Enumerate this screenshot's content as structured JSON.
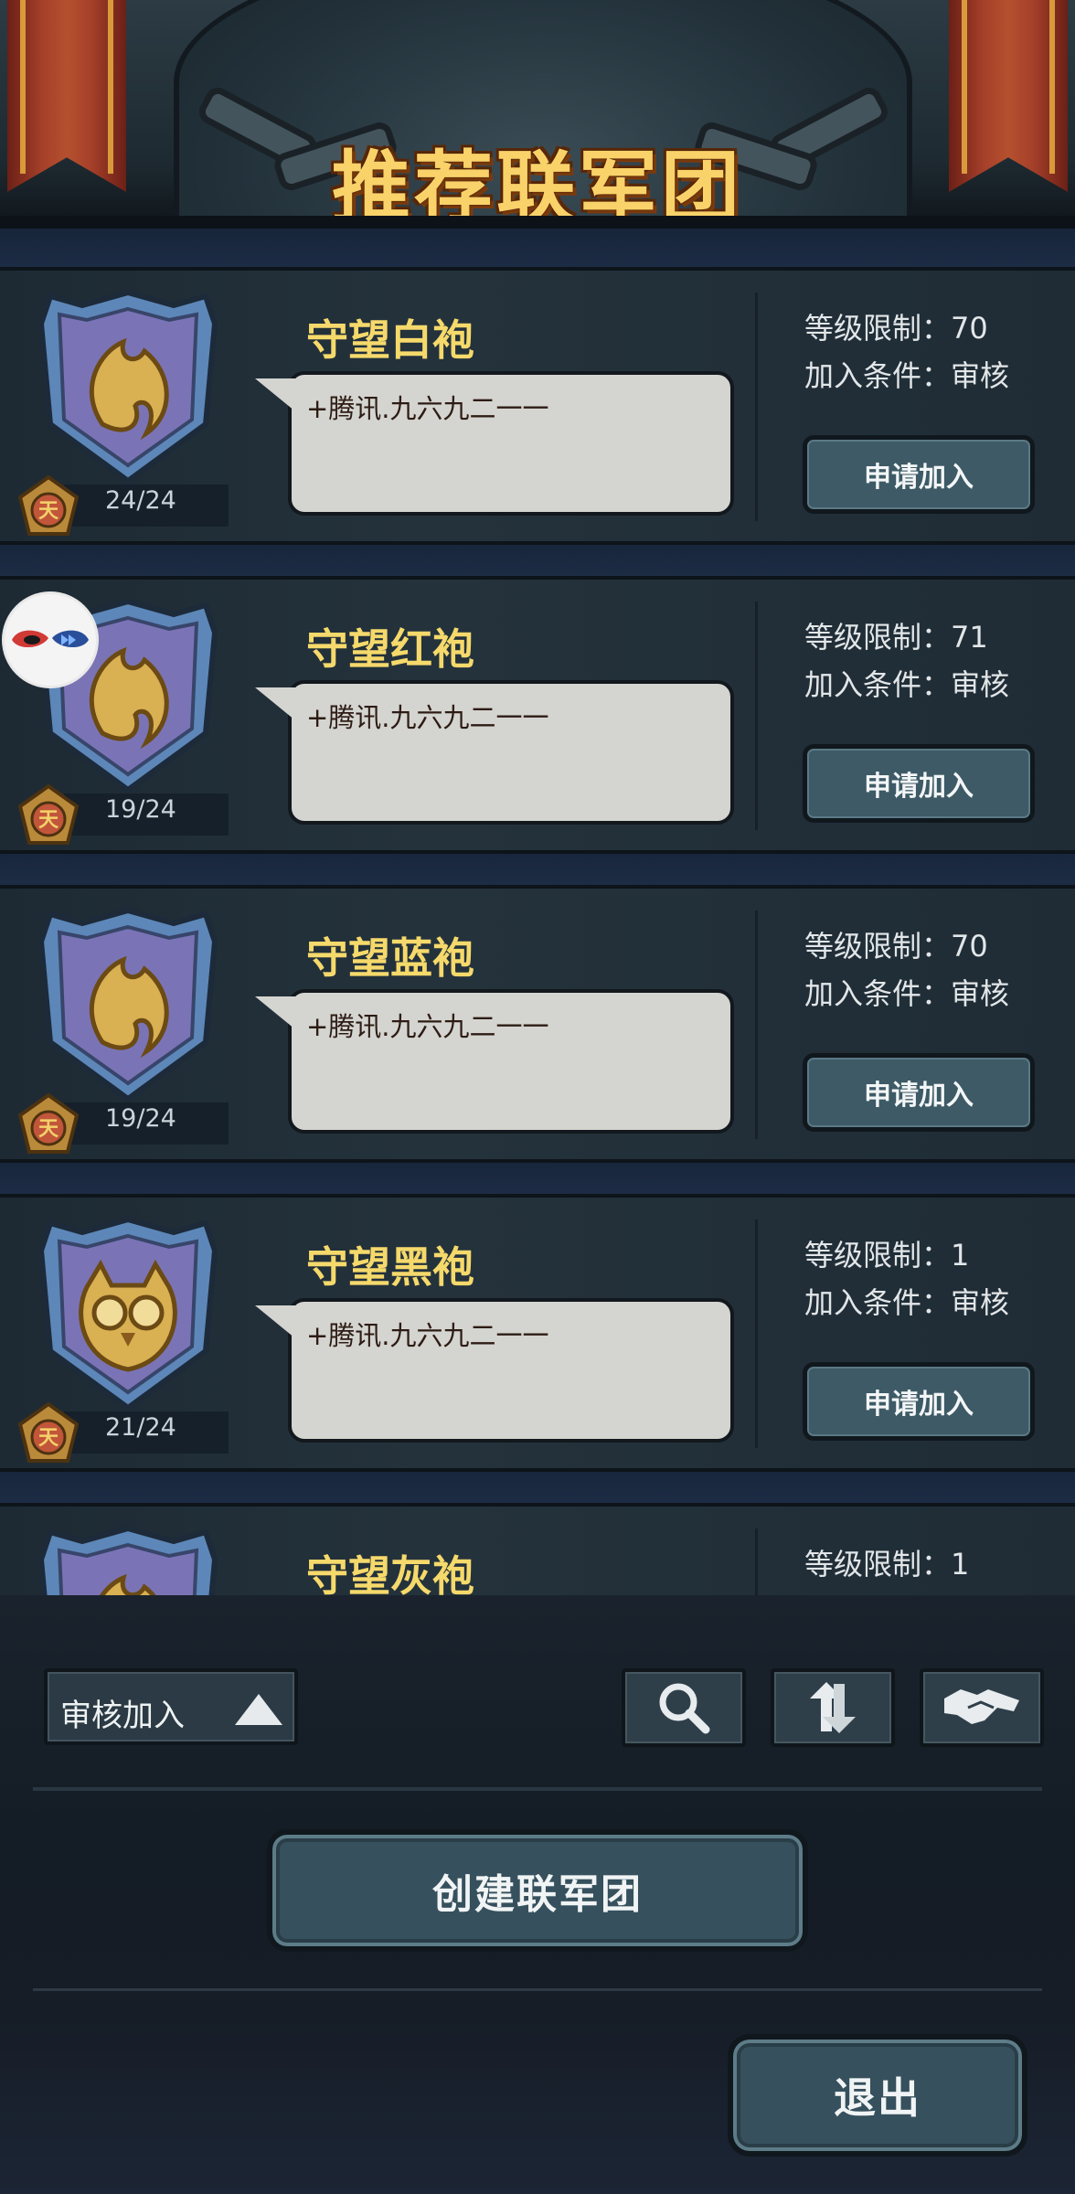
{
  "header": {
    "title": "推荐联军团"
  },
  "guilds": [
    {
      "name": "守望白袍",
      "members": "24/24",
      "message": "+腾讯.九六九二一一",
      "level_text": "等级限制：70",
      "condition_text": "加入条件：审核",
      "apply_label": "申请加入",
      "emblem": "flame-emblem"
    },
    {
      "name": "守望红袍",
      "members": "19/24",
      "message": "+腾讯.九六九二一一",
      "level_text": "等级限制：71",
      "condition_text": "加入条件：审核",
      "apply_label": "申请加入",
      "emblem": "flame-emblem"
    },
    {
      "name": "守望蓝袍",
      "members": "19/24",
      "message": "+腾讯.九六九二一一",
      "level_text": "等级限制：70",
      "condition_text": "加入条件：审核",
      "apply_label": "申请加入",
      "emblem": "flame-emblem"
    },
    {
      "name": "守望黑袍",
      "members": "21/24",
      "message": "+腾讯.九六九二一一",
      "level_text": "等级限制：1",
      "condition_text": "加入条件：审核",
      "apply_label": "申请加入",
      "emblem": "owl-emblem"
    },
    {
      "name": "守望灰袍",
      "level_text": "等级限制：1",
      "emblem": "flame-emblem"
    }
  ],
  "toolbar": {
    "filter_label": "审核加入",
    "icons": [
      "search-icon",
      "refresh-icon",
      "handshake-icon"
    ]
  },
  "actions": {
    "create_label": "创建联军团",
    "exit_label": "退出"
  },
  "colors": {
    "title": "#f9d26a",
    "guild_name": "#f5d96b",
    "button": "#3d5a66"
  }
}
